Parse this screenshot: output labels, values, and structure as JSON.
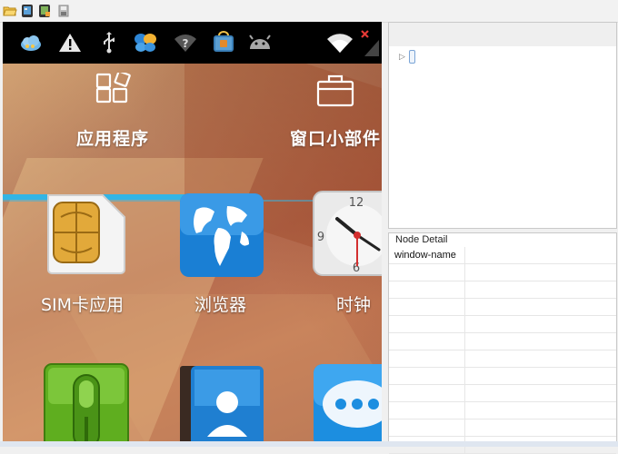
{
  "toolbar": {
    "buttons": [
      {
        "name": "open-folder-icon"
      },
      {
        "name": "screenshot-device-icon"
      },
      {
        "name": "screenshot-compressed-icon"
      },
      {
        "name": "save-icon"
      }
    ]
  },
  "device": {
    "status_icons": [
      "weather-cloud-icon",
      "warning-icon",
      "usb-icon",
      "butterfly-app-icon",
      "wifi-question-icon",
      "store-bag-icon",
      "android-icon",
      "wifi-signal-icon"
    ],
    "tabs": [
      {
        "label": "应用程序",
        "icon": "apps-grid-icon"
      },
      {
        "label": "窗口小部件",
        "icon": "widget-briefcase-icon"
      }
    ],
    "apps": [
      {
        "label": "SIM卡应用",
        "icon": "sim-card-icon"
      },
      {
        "label": "浏览器",
        "icon": "globe-icon"
      },
      {
        "label": "时钟",
        "icon": "clock-icon",
        "clock_numbers": [
          "12",
          "9",
          "6"
        ]
      },
      {
        "label": "",
        "icon": "phone-icon"
      },
      {
        "label": "",
        "icon": "contacts-icon"
      },
      {
        "label": "",
        "icon": "messaging-icon"
      }
    ]
  },
  "tree": {
    "expander": "▷"
  },
  "node_detail": {
    "title": "Node Detail",
    "rows": [
      {
        "key": "window-name",
        "value": ""
      },
      {
        "key": "",
        "value": ""
      },
      {
        "key": "",
        "value": ""
      },
      {
        "key": "",
        "value": ""
      },
      {
        "key": "",
        "value": ""
      },
      {
        "key": "",
        "value": ""
      },
      {
        "key": "",
        "value": ""
      },
      {
        "key": "",
        "value": ""
      },
      {
        "key": "",
        "value": ""
      },
      {
        "key": "",
        "value": ""
      },
      {
        "key": "",
        "value": ""
      },
      {
        "key": "",
        "value": ""
      }
    ]
  },
  "colors": {
    "tab_indicator": "#33b5e5",
    "status_bar": "#000000",
    "wifi_alert": "#e53935"
  }
}
